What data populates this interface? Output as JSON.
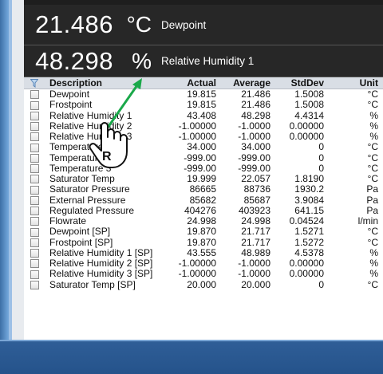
{
  "readouts": [
    {
      "value": "21.486",
      "unit": "°C",
      "label": "Dewpoint"
    },
    {
      "value": "48.298",
      "unit": "%",
      "label": "Relative Humidity 1"
    }
  ],
  "table": {
    "headers": {
      "description": "Description",
      "actual": "Actual",
      "average": "Average",
      "stddev": "StdDev",
      "units": "Unit"
    },
    "rows": [
      {
        "description": "Dewpoint",
        "actual": "19.815",
        "average": "21.486",
        "stddev": "1.5008",
        "units": "°C"
      },
      {
        "description": "Frostpoint",
        "actual": "19.815",
        "average": "21.486",
        "stddev": "1.5008",
        "units": "°C"
      },
      {
        "description": "Relative Humidity 1",
        "actual": "43.408",
        "average": "48.298",
        "stddev": "4.4314",
        "units": "%"
      },
      {
        "description": "Relative Humidity 2",
        "actual": "-1.00000",
        "average": "-1.0000",
        "stddev": "0.00000",
        "units": "%"
      },
      {
        "description": "Relative Humidity 3",
        "actual": "-1.00000",
        "average": "-1.0000",
        "stddev": "0.00000",
        "units": "%"
      },
      {
        "description": "Temperature 1",
        "actual": "34.000",
        "average": "34.000",
        "stddev": "0",
        "units": "°C"
      },
      {
        "description": "Temperature 2",
        "actual": "-999.00",
        "average": "-999.00",
        "stddev": "0",
        "units": "°C"
      },
      {
        "description": "Temperature 3",
        "actual": "-999.00",
        "average": "-999.00",
        "stddev": "0",
        "units": "°C"
      },
      {
        "description": "Saturator Temp",
        "actual": "19.999",
        "average": "22.057",
        "stddev": "1.8190",
        "units": "°C"
      },
      {
        "description": "Saturator Pressure",
        "actual": "86665",
        "average": "88736",
        "stddev": "1930.2",
        "units": "Pa"
      },
      {
        "description": "External Pressure",
        "actual": "85682",
        "average": "85687",
        "stddev": "3.9084",
        "units": "Pa"
      },
      {
        "description": "Regulated Pressure",
        "actual": "404276",
        "average": "403923",
        "stddev": "641.15",
        "units": "Pa"
      },
      {
        "description": "Flowrate",
        "actual": "24.998",
        "average": "24.998",
        "stddev": "0.04524",
        "units": "l/min"
      },
      {
        "description": "Dewpoint [SP]",
        "actual": "19.870",
        "average": "21.717",
        "stddev": "1.5271",
        "units": "°C"
      },
      {
        "description": "Frostpoint [SP]",
        "actual": "19.870",
        "average": "21.717",
        "stddev": "1.5272",
        "units": "°C"
      },
      {
        "description": "Relative Humidity 1 [SP]",
        "actual": "43.555",
        "average": "48.989",
        "stddev": "4.5378",
        "units": "%"
      },
      {
        "description": "Relative Humidity 2 [SP]",
        "actual": "-1.00000",
        "average": "-1.0000",
        "stddev": "0.00000",
        "units": "%"
      },
      {
        "description": "Relative Humidity 3 [SP]",
        "actual": "-1.00000",
        "average": "-1.0000",
        "stddev": "0.00000",
        "units": "%"
      },
      {
        "description": "Saturator Temp [SP]",
        "actual": "20.000",
        "average": "20.000",
        "stddev": "0",
        "units": "°C"
      }
    ]
  },
  "annotation": {
    "badge": "R"
  },
  "colors": {
    "readout_bg": "#272727",
    "header_bg": "#d9dee5",
    "bottom_bar": "#2a588f",
    "arrow": "#1aa84a"
  },
  "icons": {
    "filter": "filter-icon",
    "cursor": "hand-pointer-icon"
  }
}
